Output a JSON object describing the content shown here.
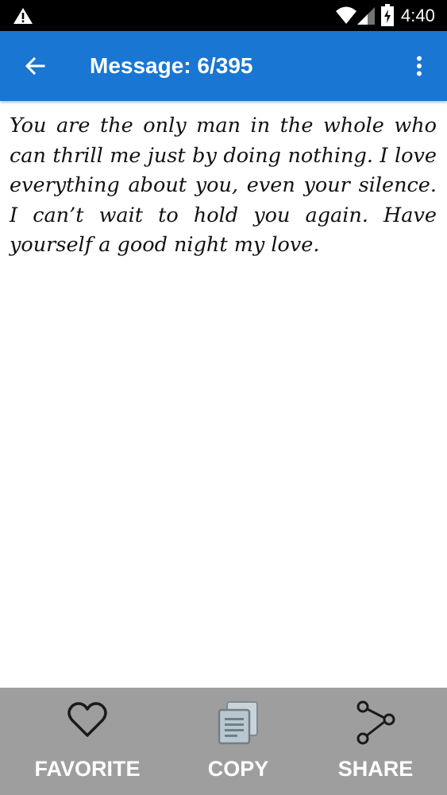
{
  "status_bar": {
    "time": "4:40",
    "icons": [
      "warning-icon",
      "wifi-icon",
      "signal-icon",
      "battery-icon"
    ]
  },
  "app_bar": {
    "title": "Message: 6/395",
    "back_icon": "arrow-back-icon",
    "menu_icon": "more-vert-icon",
    "color": "#1976d2"
  },
  "message": {
    "text": "You are the only man in the whole who can thrill me just by doing nothing. I love everything about you, even your silence. I can’t wait to hold you again. Have yourself a good night my love."
  },
  "actions": {
    "favorite": {
      "label": "FAVORITE",
      "icon": "heart-outline-icon"
    },
    "copy": {
      "label": "COPY",
      "icon": "copy-icon"
    },
    "share": {
      "label": "SHARE",
      "icon": "share-icon"
    },
    "bar_color": "#9e9e9e"
  }
}
